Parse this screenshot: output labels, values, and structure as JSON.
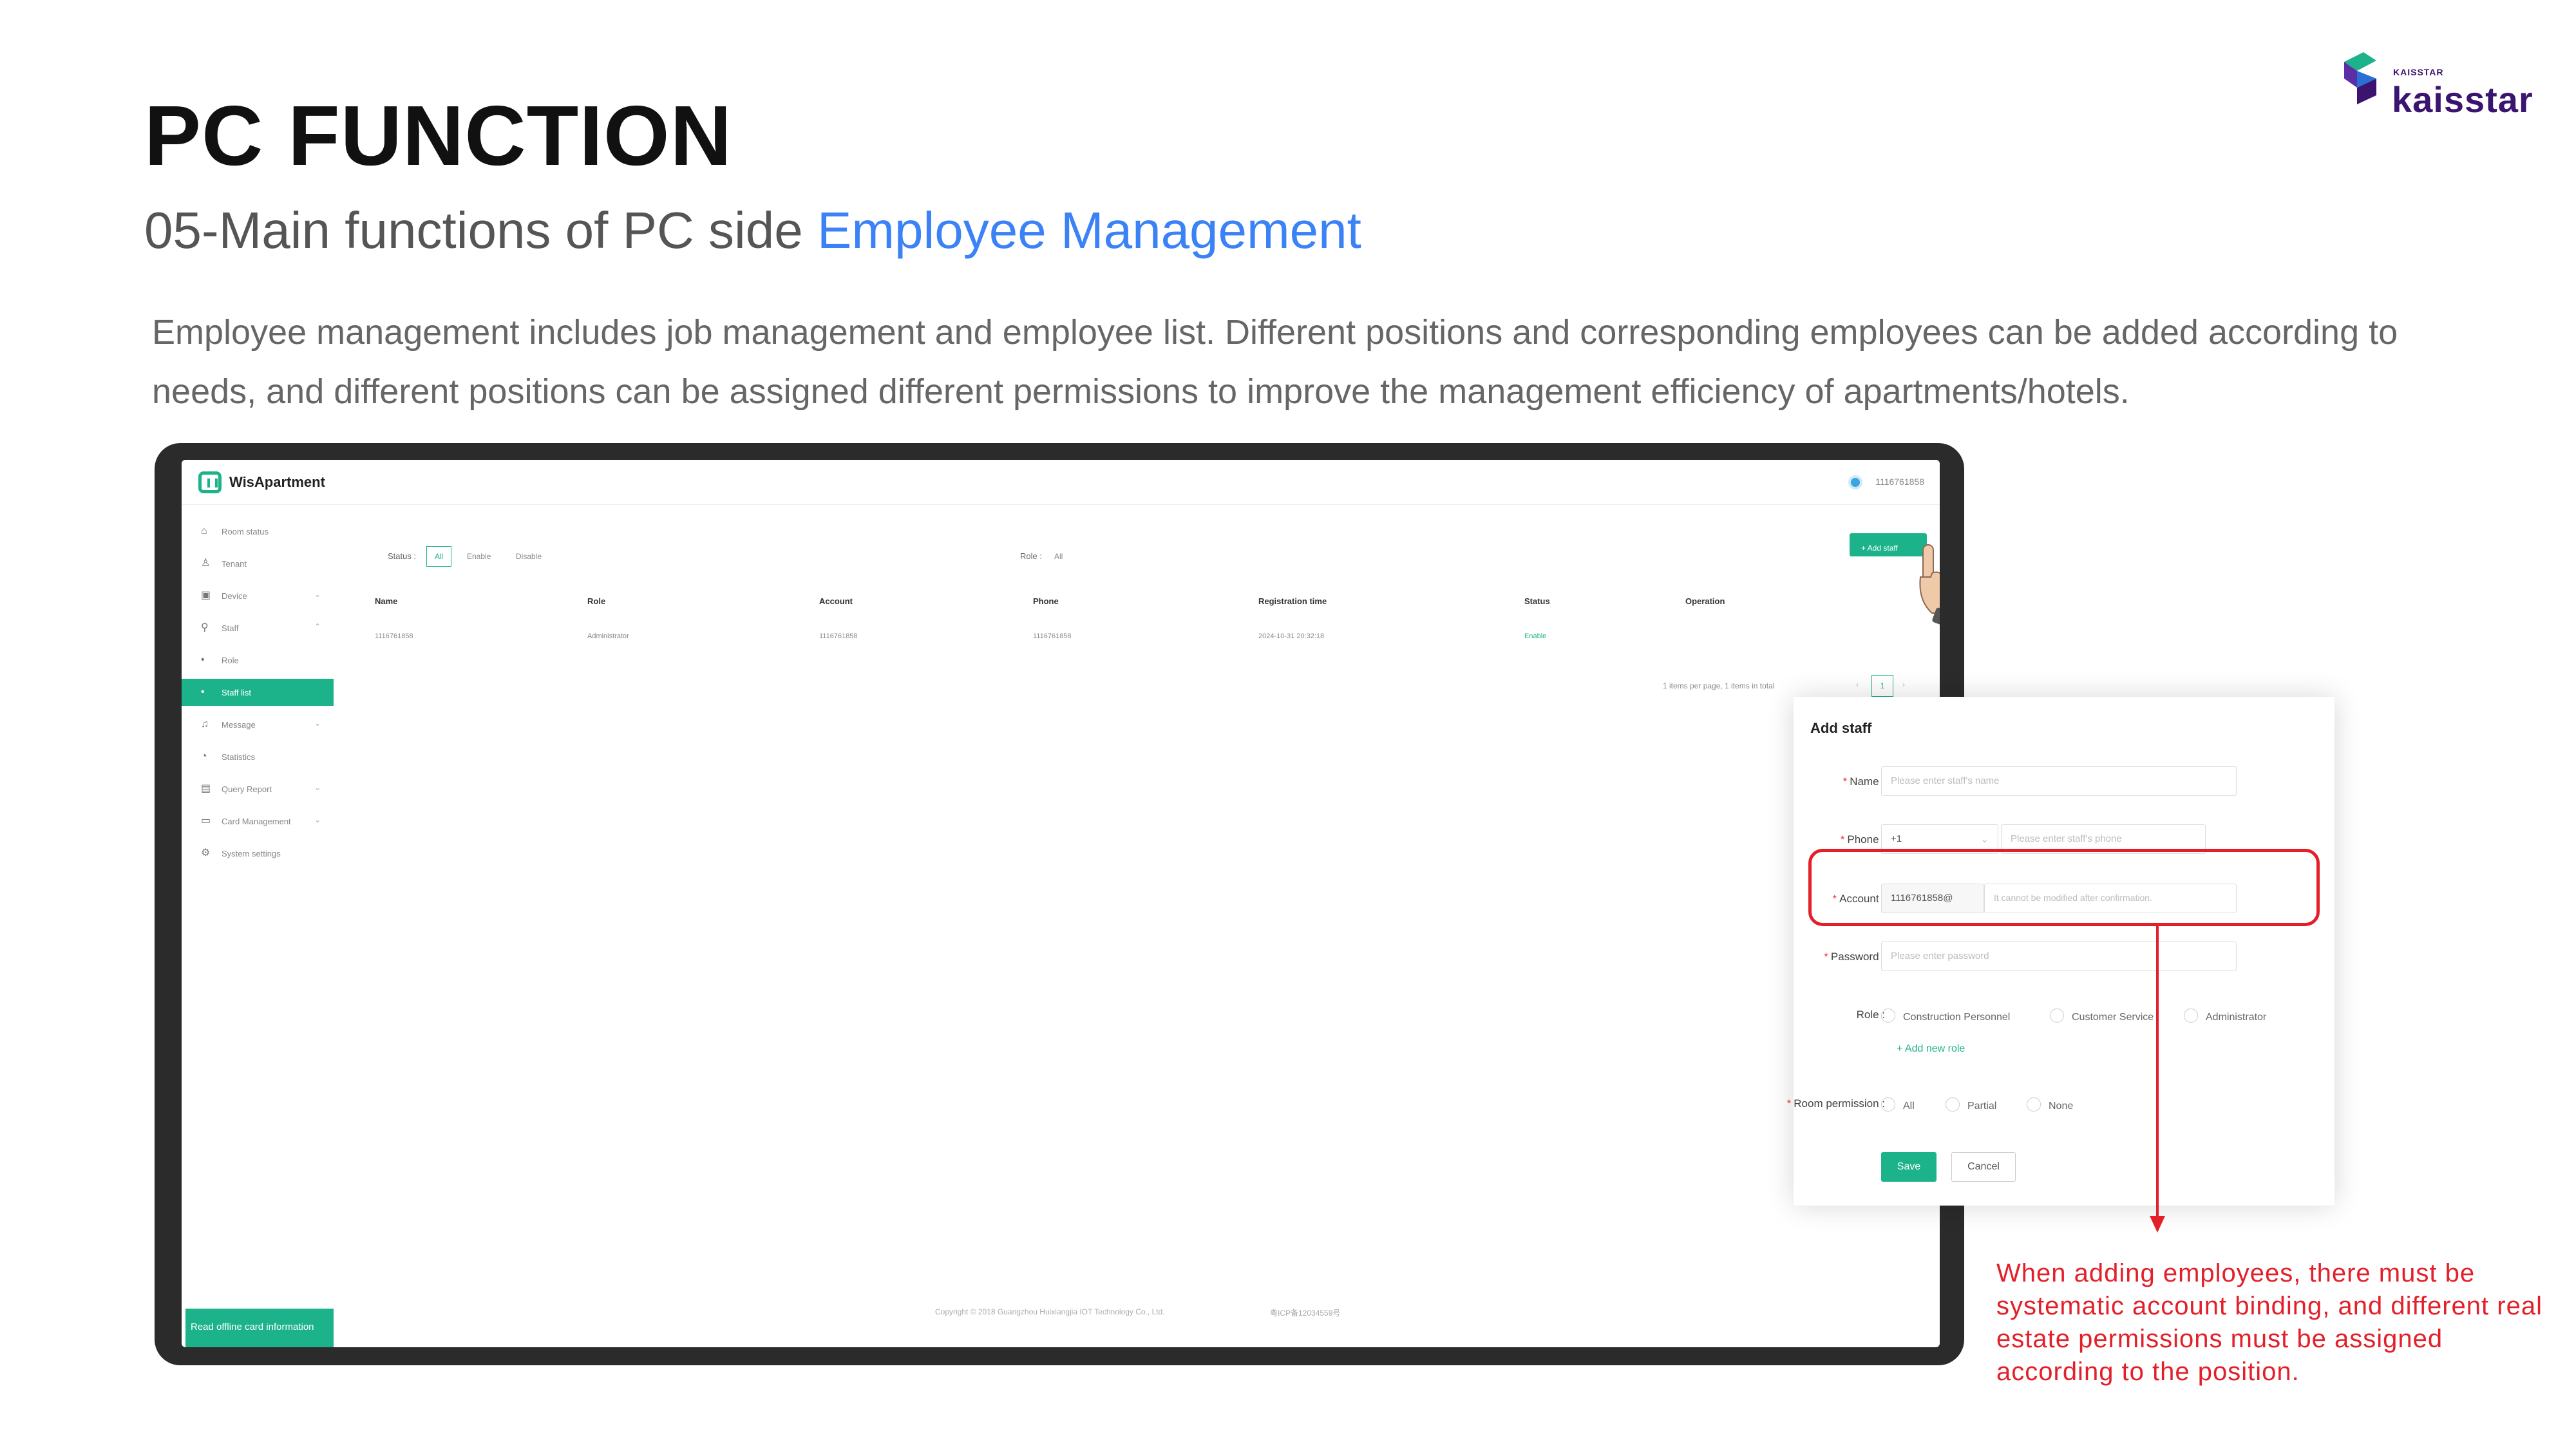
{
  "slide": {
    "title": "PC FUNCTION",
    "subtitle_prefix": "05-Main functions of PC side ",
    "subtitle_accent": "Employee Management",
    "description": "Employee management includes job management and employee list. Different positions and corresponding employees can be added according to needs, and different positions can be assigned different permissions to improve the management efficiency of apartments/hotels.",
    "callout": "When adding employees, there must be systematic account binding, and different real estate permissions must be assigned according to the position.",
    "colors": {
      "accent": "#3b82f6",
      "highlight": "#e3202a",
      "app_green": "#1db38a"
    }
  },
  "logo": {
    "small": "KAISSTAR",
    "word": "kaisstar"
  },
  "app": {
    "name": "WisApartment",
    "user": "1116761858",
    "sidebar": [
      {
        "label": "Room status",
        "icon": "home-icon"
      },
      {
        "label": "Tenant",
        "icon": "user-icon"
      },
      {
        "label": "Device",
        "icon": "device-icon",
        "chevron": "⌄"
      },
      {
        "label": "Staff",
        "icon": "staff-icon",
        "chevron": "⌃"
      },
      {
        "label": "Role",
        "icon": "dot-icon"
      },
      {
        "label": "Staff list",
        "icon": "dot-icon",
        "active": true
      },
      {
        "label": "Message",
        "icon": "bell-icon",
        "chevron": "⌄"
      },
      {
        "label": "Statistics",
        "icon": "chart-icon"
      },
      {
        "label": "Query Report",
        "icon": "report-icon",
        "chevron": "⌄"
      },
      {
        "label": "Card Management",
        "icon": "card-icon",
        "chevron": "⌄"
      },
      {
        "label": "System settings",
        "icon": "gear-icon"
      }
    ],
    "sidebar_bottom": "Read offline card information",
    "filters": {
      "status_label": "Status :",
      "status_options": [
        "All",
        "Enable",
        "Disable"
      ],
      "role_label": "Role :",
      "role_value": "All"
    },
    "add_staff_label": "+ Add staff",
    "table": {
      "headers": [
        "Name",
        "Role",
        "Account",
        "Phone",
        "Registration time",
        "Status",
        "Operation"
      ],
      "rows": [
        [
          "1116761858",
          "Administrator",
          "1116761858",
          "1116761858",
          "2024-10-31 20:32:18",
          "Enable",
          ""
        ]
      ]
    },
    "pager": {
      "info": "1 items per page, 1 items in total",
      "prev": "‹",
      "next": "›",
      "page": "1"
    },
    "footer": {
      "copyright": "Copyright © 2018 Guangzhou Huixiangjia IOT Technology Co., Ltd.",
      "icp": "粤ICP备12034559号"
    }
  },
  "dialog": {
    "title": "Add staff",
    "name_label": "Name :",
    "name_placeholder": "Please enter staff's name",
    "phone_label": "Phone :",
    "phone_code": "+1",
    "phone_placeholder": "Please enter staff's phone",
    "account_label": "Account :",
    "account_prefix": "1116761858@",
    "account_placeholder": "It cannot be modified after confirmation.",
    "password_label": "Password :",
    "password_placeholder": "Please enter password",
    "role_label": "Role :",
    "roles": [
      "Construction Personnel",
      "Customer Service",
      "Administrator"
    ],
    "add_role": "+ Add new role",
    "room_permission_label": "Room permission :",
    "room_permissions": [
      "All",
      "Partial",
      "None"
    ],
    "save": "Save",
    "cancel": "Cancel"
  }
}
